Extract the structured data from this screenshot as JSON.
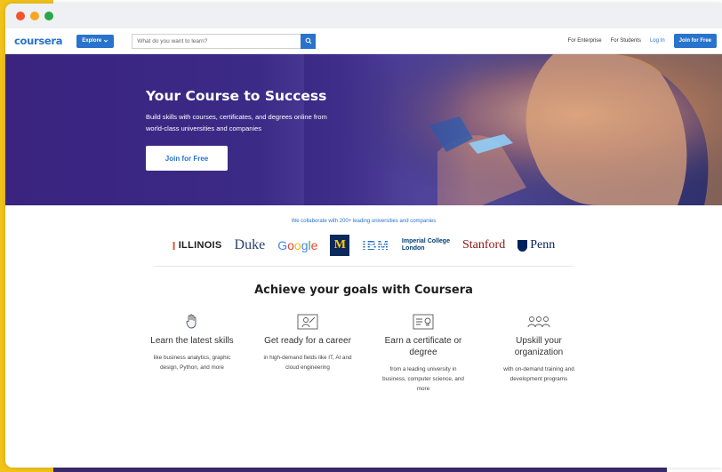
{
  "window": {
    "controls": [
      "close",
      "minimize",
      "maximize"
    ]
  },
  "navbar": {
    "logo": "coursera",
    "explore_label": "Explore",
    "search_placeholder": "What do you want to learn?",
    "links": {
      "enterprise": "For Enterprise",
      "students": "For Students",
      "login": "Log In"
    },
    "join_label": "Join for Free"
  },
  "hero": {
    "title": "Your Course to Success",
    "subtitle": "Build skills with courses, certificates, and degrees online from world-class universities and companies",
    "cta": "Join for Free"
  },
  "partners": {
    "caption": "We collaborate with 200+ leading universities and companies",
    "logos": [
      "ILLINOIS",
      "Duke",
      "Google",
      "M",
      "IBM",
      "Imperial College",
      "London",
      "Stanford",
      "Penn"
    ]
  },
  "goals": {
    "title": "Achieve your goals with Coursera",
    "features": [
      {
        "icon": "hand-icon",
        "title": "Learn the latest skills",
        "desc": "like business analytics, graphic design, Python, and more"
      },
      {
        "icon": "career-icon",
        "title": "Get ready for a career",
        "desc": "in high-demand fields like IT, AI and cloud engineering"
      },
      {
        "icon": "certificate-icon",
        "title": "Earn a certificate or degree",
        "desc": "from a leading university in business, computer science, and more"
      },
      {
        "icon": "team-icon",
        "title": "Upskill your organization",
        "desc": "with on-demand training and development programs"
      }
    ]
  },
  "colors": {
    "brand": "#2a73cc",
    "hero_bg": "#3a2480",
    "backdrop_yellow": "#f2c31b"
  }
}
